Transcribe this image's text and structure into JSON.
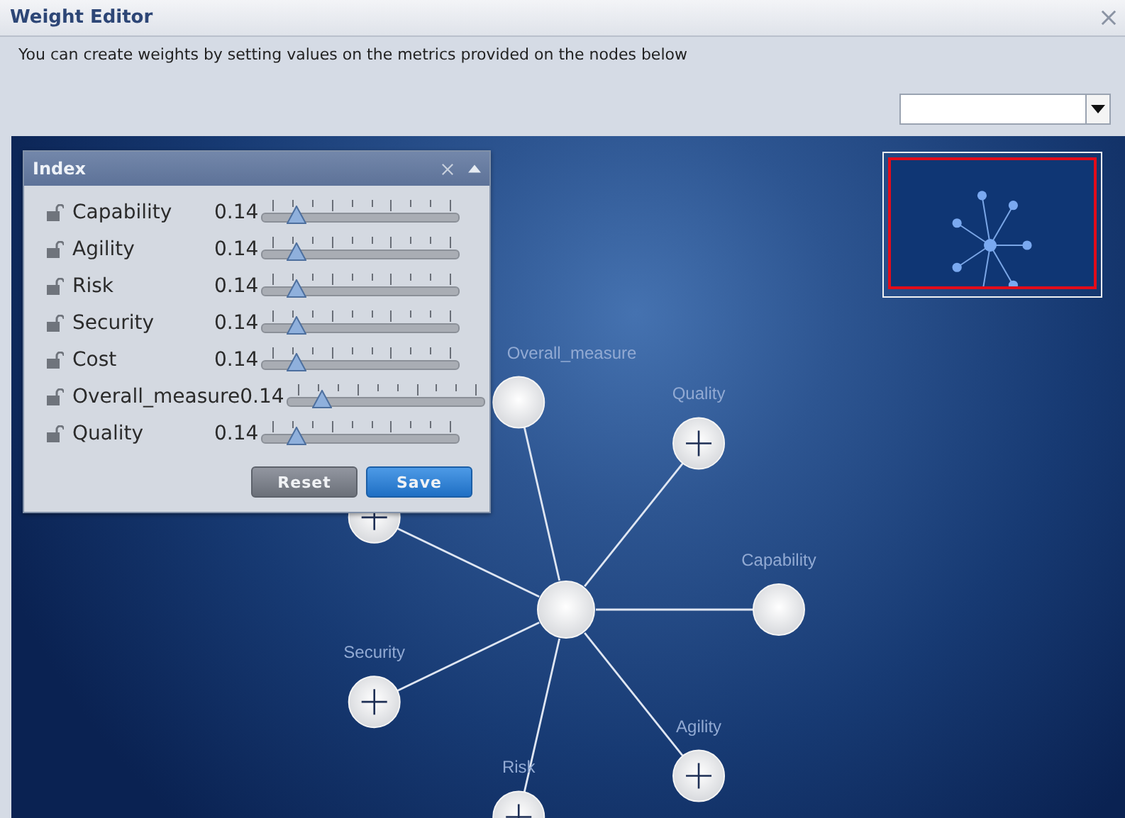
{
  "window": {
    "title": "Weight Editor"
  },
  "description": "You can create weights by setting values on the metrics provided on the nodes below",
  "index_panel": {
    "title": "Index",
    "metrics": [
      {
        "name": "Capability",
        "value": "0.14",
        "level": 0.14,
        "locked": false
      },
      {
        "name": "Agility",
        "value": "0.14",
        "level": 0.14,
        "locked": false
      },
      {
        "name": "Risk",
        "value": "0.14",
        "level": 0.14,
        "locked": false
      },
      {
        "name": "Security",
        "value": "0.14",
        "level": 0.14,
        "locked": false
      },
      {
        "name": "Cost",
        "value": "0.14",
        "level": 0.14,
        "locked": false
      },
      {
        "name": "Overall_measure",
        "value": "0.14",
        "level": 0.14,
        "locked": false
      },
      {
        "name": "Quality",
        "value": "0.14",
        "level": 0.14,
        "locked": false
      }
    ],
    "buttons": [
      {
        "label": "Reset",
        "kind": "secondary"
      },
      {
        "label": "Save",
        "kind": "primary"
      }
    ]
  },
  "graph": {
    "nodes": [
      {
        "label": "Capability",
        "expandable": false
      },
      {
        "label": "Agility",
        "expandable": true
      },
      {
        "label": "Risk",
        "expandable": true
      },
      {
        "label": "Security",
        "expandable": true
      },
      {
        "expandable": true
      },
      {
        "label": "Overall_measure",
        "expandable": false
      },
      {
        "label": "Quality",
        "expandable": true
      }
    ]
  }
}
